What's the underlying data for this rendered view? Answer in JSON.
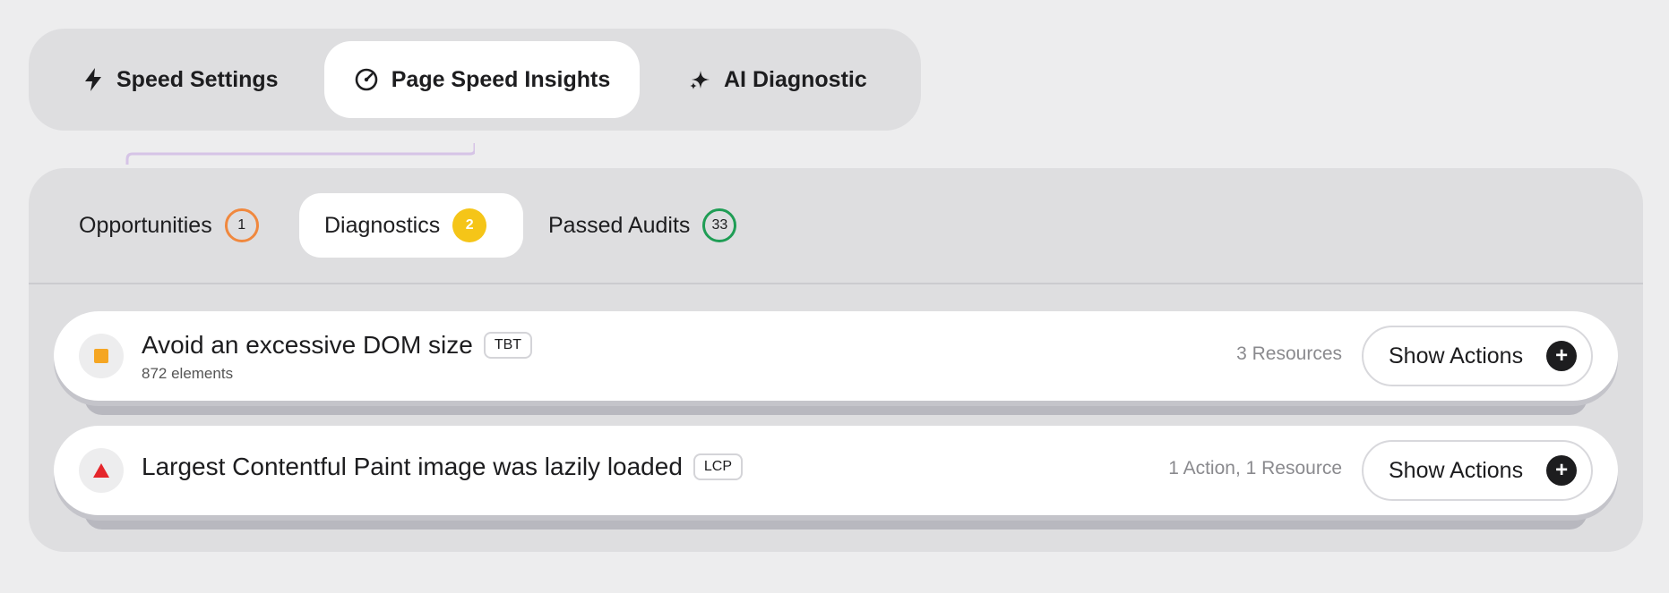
{
  "top_tabs": [
    {
      "label": "Speed Settings",
      "icon": "lightning-icon"
    },
    {
      "label": "Page Speed Insights",
      "icon": "gauge-icon",
      "active": true
    },
    {
      "label": "AI Diagnostic",
      "icon": "sparkle-icon"
    }
  ],
  "sub_tabs": [
    {
      "label": "Opportunities",
      "count": "1",
      "color": "#f0883e"
    },
    {
      "label": "Diagnostics",
      "count": "2",
      "color": "#f5c518",
      "active": true
    },
    {
      "label": "Passed Audits",
      "count": "33",
      "color": "#1f9d55"
    }
  ],
  "audits": [
    {
      "title": "Avoid an excessive DOM size",
      "tag": "TBT",
      "subtitle": "872 elements",
      "resources": "3 Resources",
      "action_label": "Show Actions",
      "status_icon": "orange-square-icon",
      "status_color": "#f5a623"
    },
    {
      "title": "Largest Contentful Paint image was lazily loaded",
      "tag": "LCP",
      "resources": "1 Action, 1 Resource",
      "action_label": "Show Actions",
      "status_icon": "red-triangle-icon",
      "status_color": "#e5262b"
    }
  ],
  "colors": {
    "background": "#ededee",
    "panel": "#dedee0",
    "connector": "#d6c4e6"
  }
}
